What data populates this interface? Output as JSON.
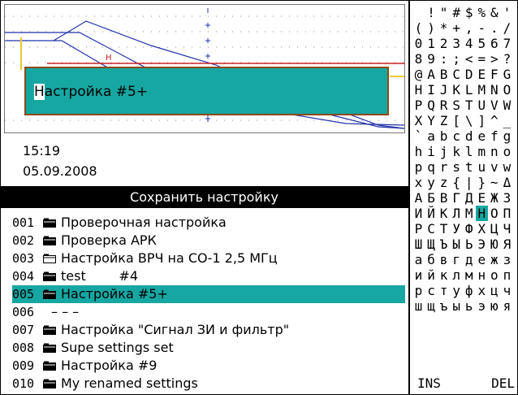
{
  "preview": {
    "dialog_text": "Настройка #5+",
    "dialog_cursor_char": "Н",
    "dialog_rest": "астройка #5+",
    "marker_label": "H"
  },
  "clock": {
    "time": "15:19",
    "date": "05.09.2008"
  },
  "header": {
    "title": "Сохранить настройку"
  },
  "settings": [
    {
      "num": "001",
      "icon": "folder-filled-icon",
      "name": "Проверочная настройка",
      "selected": false
    },
    {
      "num": "002",
      "icon": "folder-filled-icon",
      "name": "Проверка АРК",
      "selected": false
    },
    {
      "num": "003",
      "icon": "folder-empty-icon",
      "name": "Настройка ВРЧ на СО-1 2,5 МГц",
      "selected": false
    },
    {
      "num": "004",
      "icon": "folder-filled-icon",
      "name": "test        #4",
      "selected": false
    },
    {
      "num": "005",
      "icon": "folder-filled-icon",
      "name": "Настройка #5+",
      "selected": true
    },
    {
      "num": "006",
      "icon": "none",
      "name": "– – –",
      "selected": false
    },
    {
      "num": "007",
      "icon": "folder-filled-icon",
      "name": "Настройка \"Сигнал ЗИ и фильтр\"",
      "selected": false
    },
    {
      "num": "008",
      "icon": "folder-filled-icon",
      "name": "Supe settings set",
      "selected": false
    },
    {
      "num": "009",
      "icon": "folder-filled-icon",
      "name": "Настройка #9",
      "selected": false
    },
    {
      "num": "010",
      "icon": "folder-filled-icon",
      "name": "My renamed settings",
      "selected": false
    }
  ],
  "charset": {
    "rows": [
      [
        " ",
        "!",
        "\"",
        "#",
        "$",
        "%",
        "&",
        "'"
      ],
      [
        "(",
        ")",
        "*",
        "+",
        ",",
        "-",
        ".",
        "/"
      ],
      [
        "0",
        "1",
        "2",
        "3",
        "4",
        "5",
        "6",
        "7"
      ],
      [
        "8",
        "9",
        ":",
        ";",
        "<",
        "=",
        ">",
        "?"
      ],
      [
        "@",
        "A",
        "B",
        "C",
        "D",
        "E",
        "F",
        "G"
      ],
      [
        "H",
        "I",
        "J",
        "K",
        "L",
        "M",
        "N",
        "O"
      ],
      [
        "P",
        "Q",
        "R",
        "S",
        "T",
        "U",
        "V",
        "W"
      ],
      [
        "X",
        "Y",
        "Z",
        "[",
        "\\",
        "]",
        "^",
        "_"
      ],
      [
        "`",
        "a",
        "b",
        "c",
        "d",
        "e",
        "f",
        "g"
      ],
      [
        "h",
        "i",
        "j",
        "k",
        "l",
        "m",
        "n",
        "o"
      ],
      [
        "p",
        "q",
        "r",
        "s",
        "t",
        "u",
        "v",
        "w"
      ],
      [
        "x",
        "y",
        "z",
        "{",
        "|",
        "}",
        "~",
        "Δ"
      ],
      [
        "А",
        "Б",
        "В",
        "Г",
        "Д",
        "Е",
        "Ж",
        "З"
      ],
      [
        "И",
        "Й",
        "К",
        "Л",
        "М",
        "Н",
        "О",
        "П"
      ],
      [
        "Р",
        "С",
        "Т",
        "У",
        "Ф",
        "Х",
        "Ц",
        "Ч"
      ],
      [
        "Ш",
        "Щ",
        "Ъ",
        "Ы",
        "Ь",
        "Э",
        "Ю",
        "Я"
      ],
      [
        "а",
        "б",
        "в",
        "г",
        "д",
        "е",
        "ж",
        "з"
      ],
      [
        "и",
        "й",
        "к",
        "л",
        "м",
        "н",
        "о",
        "п"
      ],
      [
        "р",
        "с",
        "т",
        "у",
        "ф",
        "х",
        "ц",
        "ч"
      ],
      [
        "ш",
        "щ",
        "ъ",
        "ы",
        "ь",
        "э",
        "ю",
        "я"
      ]
    ],
    "highlighted": "Н",
    "ins_label": "INS",
    "del_label": "DEL"
  },
  "colors": {
    "selection": "#17a7a2",
    "dialog_border": "#8b4b17",
    "curve": "#2233aa",
    "gate": "#cc2222",
    "signal": "#e8c830"
  }
}
